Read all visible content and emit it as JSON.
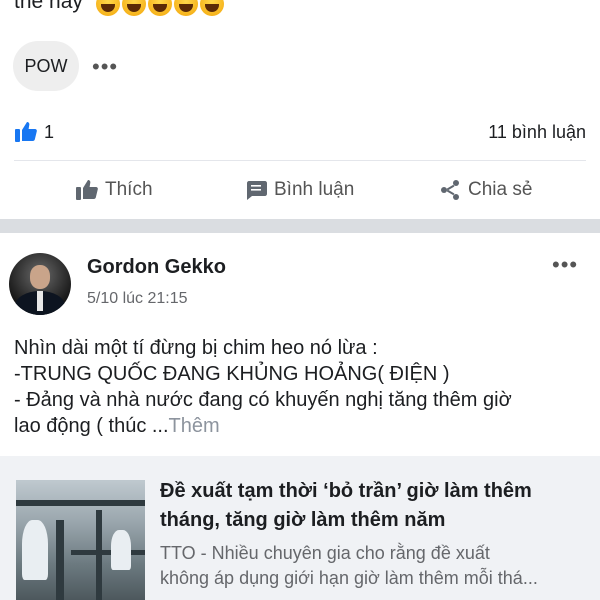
{
  "previous_post": {
    "text_fragment": "thế hay",
    "emoji_count": 5,
    "reaction_button_label": "POW",
    "more_icon": "more-horizontal-icon",
    "like_count": "1",
    "comment_count": "11 bình luận",
    "actions": {
      "like": "Thích",
      "comment": "Bình luận",
      "share": "Chia sẻ"
    }
  },
  "post": {
    "author": "Gordon Gekko",
    "timestamp": "5/10 lúc 21:15",
    "body_lines": [
      "Nhìn dài một tí đừng bị chim heo nó lừa :",
      "-TRUNG QUỐC ĐANG KHỦNG HOẢNG(  ĐIỆN  )",
      "- Đảng và nhà nước đang có khuyến nghị tăng thêm giờ",
      "lao động ( thúc ..."
    ],
    "see_more": "Thêm",
    "link_preview": {
      "title": "Đề xuất tạm thời ‘bỏ trần’ giờ làm thêm tháng, tăng giờ làm thêm năm",
      "description_lines": [
        "TTO - Nhiều chuyên gia cho rằng đề xuất",
        "không áp dụng giới hạn giờ làm thêm mỗi thá..."
      ]
    }
  },
  "colors": {
    "like_blue": "#1877f2",
    "text": "#1c1e21",
    "secondary": "#65676b",
    "gap": "#dadde1"
  }
}
